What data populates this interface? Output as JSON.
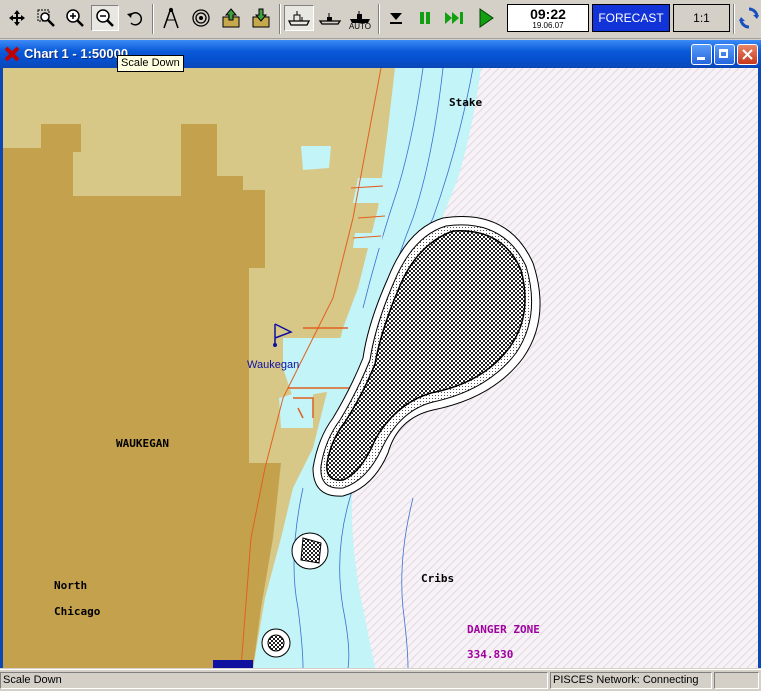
{
  "toolbar": {
    "buttons": [
      "move-icon",
      "zoom-area-icon",
      "zoom-in-icon",
      "scale-down-icon",
      "undo-icon",
      "compass-icon",
      "target-icon",
      "export-icon",
      "import-icon",
      "ship-view-icon",
      "ship-flat-icon",
      "auto-mode-icon",
      "stop-icon",
      "pause-icon",
      "fast-forward-icon",
      "play-icon",
      "network-icon"
    ],
    "auto_label": "AUTO",
    "clock_time": "09:22",
    "clock_date": "19.06.07",
    "forecast_label": "FORECAST",
    "scale_label": "1:1",
    "forecast_color": "#1133d8"
  },
  "window": {
    "title": "Chart 1 - 1:50000",
    "buttons": [
      "minimize-icon",
      "maximize-icon",
      "close-icon"
    ]
  },
  "tooltip": {
    "text": "Scale Down"
  },
  "map": {
    "labels": {
      "stake": "Stake",
      "waukegan_small": "Waukegan",
      "waukegan_big": "WAUKEGAN",
      "north": "North",
      "chicago": "Chicago",
      "cribs": "Cribs",
      "danger_zone": "DANGER ZONE",
      "danger_value": "334.830"
    },
    "colors": {
      "land": "#d7c888",
      "urban": "#c4a24d",
      "shallow_water": "#c3f4f8",
      "deep_water": "#ffffff",
      "danger": "#a000a0",
      "label_blue": "#1010a0"
    }
  },
  "status": {
    "left": "Scale Down",
    "network": "PISCES Network: Connecting",
    "extra": ""
  }
}
